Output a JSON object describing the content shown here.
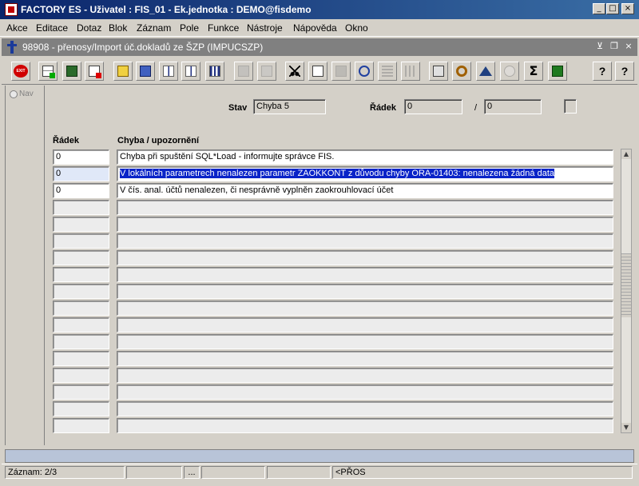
{
  "window": {
    "title": "FACTORY ES - Uživatel : FIS_01 - Ek.jednotka : DEMO@fisdemo",
    "buttons": {
      "minimize": "_",
      "maximize": "□",
      "close": "×"
    }
  },
  "menu": [
    "Akce",
    "Editace",
    "Dotaz",
    "Blok",
    "Záznam",
    "Pole",
    "Funkce",
    "Nástroje",
    "Nápověda",
    "Okno"
  ],
  "form": {
    "title": "98908 - přenosy/Import úč.dokladů ze ŠZP (IMPUCSZP)",
    "buttons": {
      "min": "⊻",
      "restore": "❐",
      "close": "×"
    }
  },
  "toolbar": {
    "exit_label": "EXIT",
    "icons": [
      "exit-icon",
      "insert-record-icon",
      "save-icon",
      "delete-record-icon",
      "query-enter-icon",
      "query-execute-icon",
      "sort-asc-icon",
      "sort-desc-icon",
      "sort-multi-icon",
      "print-icon",
      "print-setup-icon",
      "cut-icon",
      "copy-icon",
      "paste-icon",
      "find-icon",
      "list-icon",
      "columns-icon",
      "calculator-icon",
      "settings-icon",
      "triangle-icon",
      "calendar-icon",
      "sum-icon",
      "excel-icon",
      "help-icon",
      "context-help-icon"
    ]
  },
  "nav": {
    "label": "Nav"
  },
  "header": {
    "stav_label": "Stav",
    "stav_value": "Chyba 5",
    "radek_label": "Řádek",
    "radek_value": "0",
    "separator": "/",
    "radek_total": "0"
  },
  "table": {
    "columns": [
      "Řádek",
      "Chyba / upozornění"
    ],
    "rows": [
      {
        "radek": "0",
        "chyba": "Chyba při spuštění SQL*Load - informujte správce FIS."
      },
      {
        "radek": "0",
        "chyba": "V lokálních parametrech nenalezen parametr ZAOKKONT z důvodu chyby ORA-01403: nenalezena žádná data"
      },
      {
        "radek": "0",
        "chyba": "V čís. anal. účtů nenalezen, či nesprávně vyplněn zaokrouhlovací účet"
      }
    ],
    "selected_row": 1,
    "empty_rows": 14
  },
  "status": {
    "record": "Záznam: 2/3",
    "dots": "...",
    "mode": "<PŘOS"
  }
}
